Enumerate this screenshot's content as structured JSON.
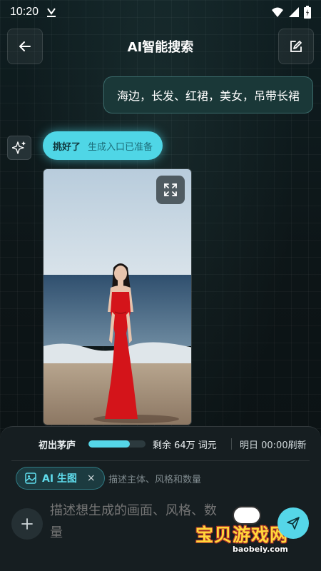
{
  "status": {
    "time": "10:20"
  },
  "header": {
    "title": "AI智能搜索"
  },
  "chat": {
    "user_message": "海边，长发、红裙，美女，吊带长裙",
    "ai_status": "挑好了",
    "ai_status_sub": "生成入口已准备"
  },
  "quota": {
    "level": "初出茅庐",
    "progress": 0.72,
    "remaining": "剩余 64万 词元",
    "refresh": "明日 00:00刷新"
  },
  "composer": {
    "chip_label": "AI 生图",
    "chip_close": "×",
    "hint": "描述主体、风格和数量",
    "placeholder": "描述想生成的画面、风格、数量"
  },
  "watermark": {
    "text": "宝贝游戏网",
    "url": "baobeiy.com"
  },
  "colors": {
    "accent": "#55d6e8",
    "background": "#0d1517",
    "dress": "#d4141a"
  },
  "icons": [
    "back-arrow-icon",
    "edit-icon",
    "sparkle-icon",
    "expand-icon",
    "image-icon",
    "plus-icon",
    "send-icon",
    "wifi-icon",
    "signal-icon",
    "battery-icon",
    "download-icon"
  ]
}
